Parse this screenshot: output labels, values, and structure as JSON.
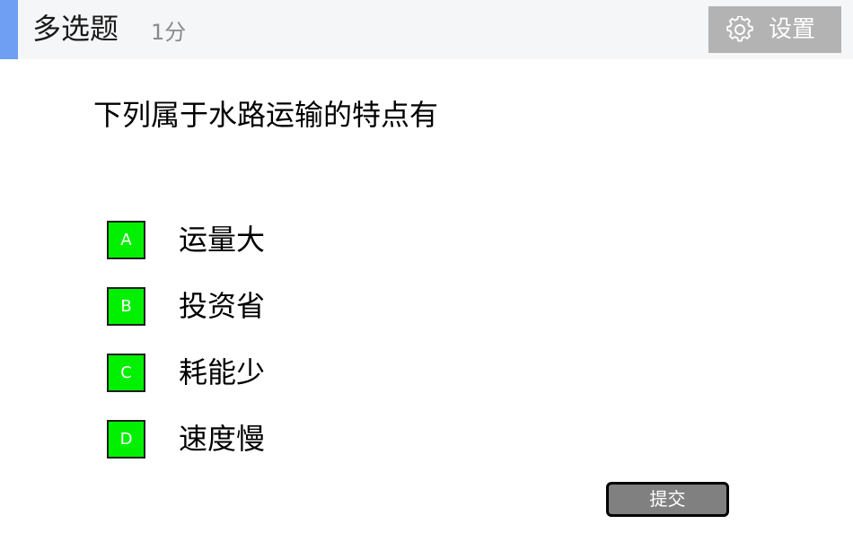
{
  "header": {
    "question_type": "多选题",
    "score": "1分",
    "settings_label": "设置",
    "accent_color": "#6f9ff3"
  },
  "question": {
    "text": "下列属于水路运输的特点有"
  },
  "options": [
    {
      "letter": "A",
      "text": "运量大"
    },
    {
      "letter": "B",
      "text": "投资省"
    },
    {
      "letter": "C",
      "text": "耗能少"
    },
    {
      "letter": "D",
      "text": "速度慢"
    }
  ],
  "option_box_color": "#00f000",
  "submit": {
    "label": "提交"
  },
  "icons": {
    "settings": "gear-icon"
  }
}
